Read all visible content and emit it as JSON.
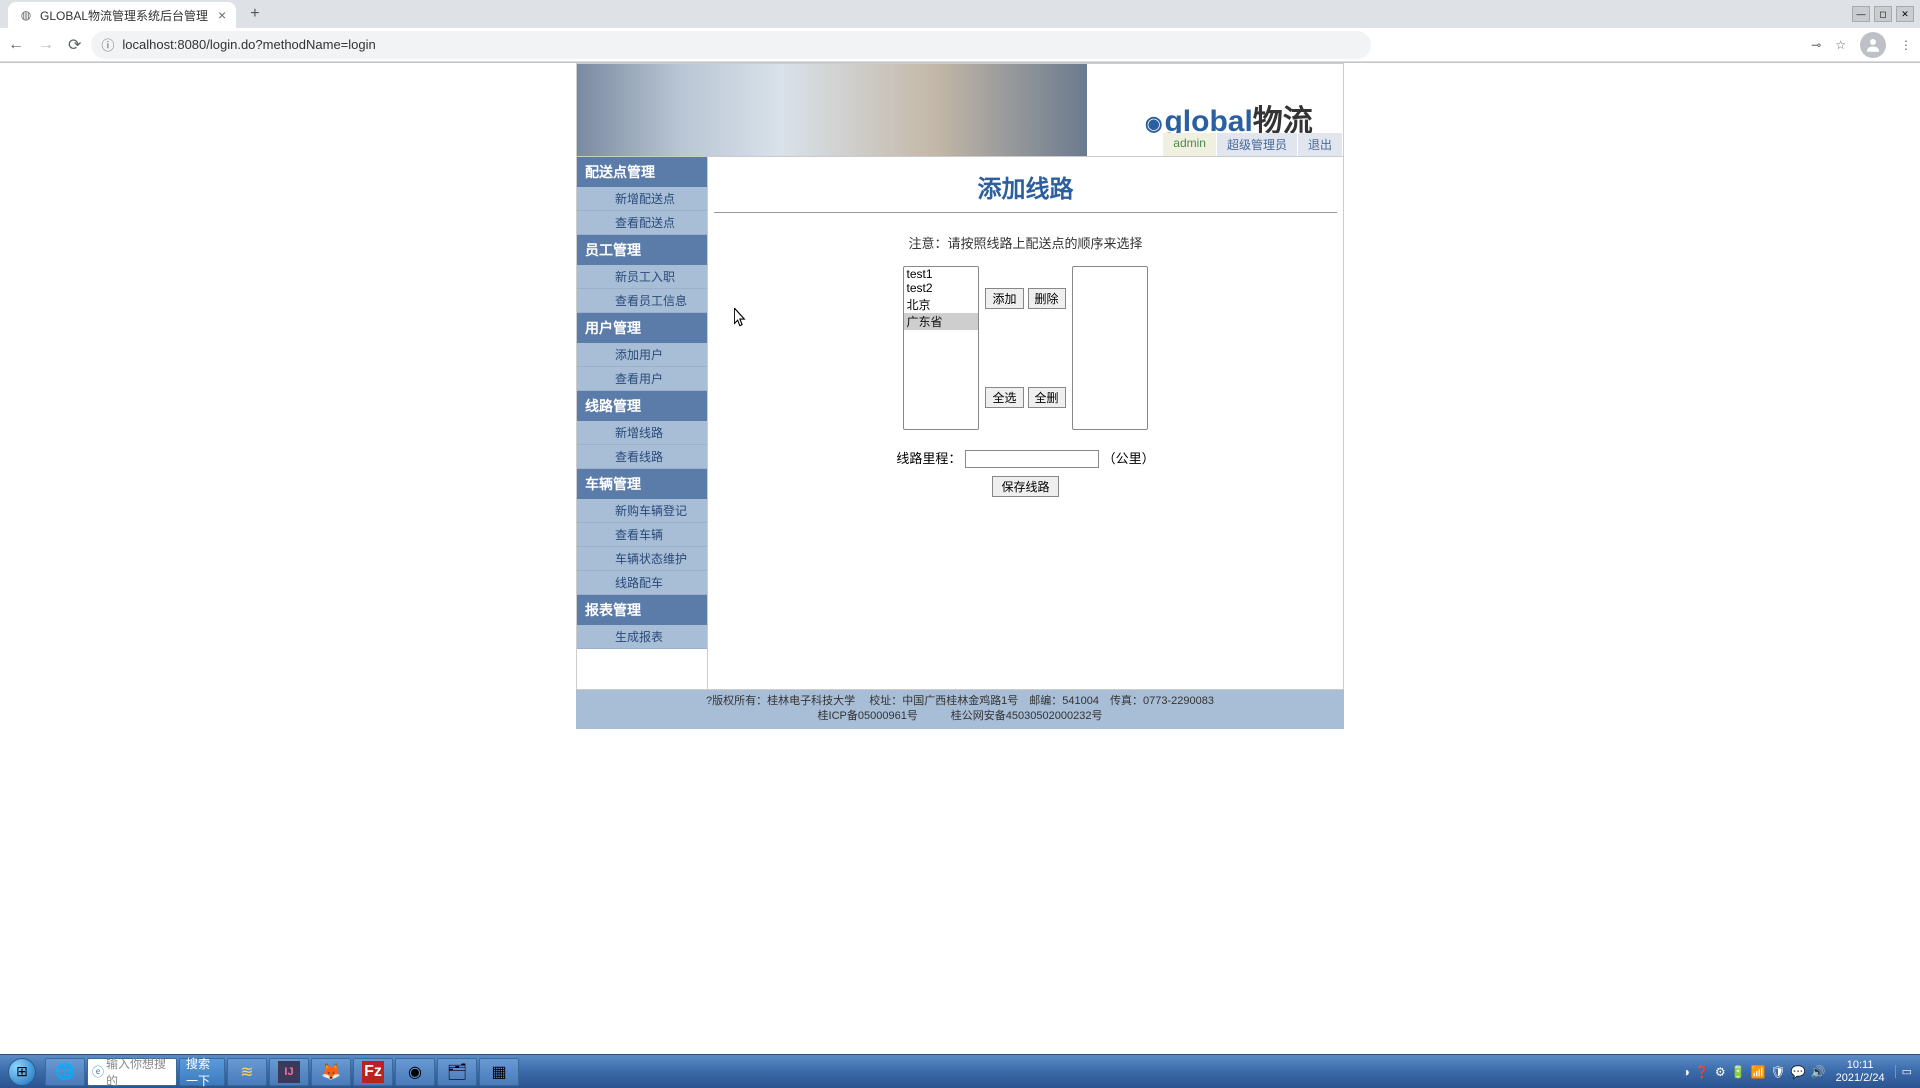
{
  "browser": {
    "tab_title": "GLOBAL物流管理系统后台管理",
    "url": "localhost:8080/login.do?methodName=login"
  },
  "header": {
    "logo_text_blue": "global",
    "logo_text_black": "物流",
    "user": "admin",
    "role": "超级管理员",
    "logout": "退出"
  },
  "sidebar": [
    {
      "type": "header",
      "label": "配送点管理"
    },
    {
      "type": "item",
      "label": "新增配送点"
    },
    {
      "type": "item",
      "label": "查看配送点"
    },
    {
      "type": "header",
      "label": "员工管理"
    },
    {
      "type": "item",
      "label": "新员工入职"
    },
    {
      "type": "item",
      "label": "查看员工信息"
    },
    {
      "type": "header",
      "label": "用户管理"
    },
    {
      "type": "item",
      "label": "添加用户"
    },
    {
      "type": "item",
      "label": "查看用户"
    },
    {
      "type": "header",
      "label": "线路管理"
    },
    {
      "type": "item",
      "label": "新增线路"
    },
    {
      "type": "item",
      "label": "查看线路"
    },
    {
      "type": "header",
      "label": "车辆管理"
    },
    {
      "type": "item",
      "label": "新购车辆登记"
    },
    {
      "type": "item",
      "label": "查看车辆"
    },
    {
      "type": "item",
      "label": "车辆状态维护"
    },
    {
      "type": "item",
      "label": "线路配车"
    },
    {
      "type": "header",
      "label": "报表管理"
    },
    {
      "type": "item",
      "label": "生成报表"
    }
  ],
  "main": {
    "title": "添加线路",
    "notice": "注意：请按照线路上配送点的顺序来选择",
    "left_options": [
      "test1",
      "test2",
      "北京",
      "广东省"
    ],
    "selected_option": "广东省",
    "right_options": [],
    "btn_add": "添加",
    "btn_remove": "删除",
    "btn_all": "全选",
    "btn_all_remove": "全删",
    "distance_label": "线路里程：",
    "distance_unit": "（公里）",
    "distance_value": "",
    "btn_save": "保存线路"
  },
  "footer": {
    "line1": "?版权所有：桂林电子科技大学　 校址：中国广西桂林金鸡路1号　邮编：541004　传真：0773-2290083",
    "line2": "桂ICP备05000961号　　　桂公网安备45030502000232号"
  },
  "taskbar": {
    "search_placeholder": "输入你想搜的",
    "search_btn": "搜索一下",
    "time": "10:11",
    "date": "2021/2/24"
  }
}
